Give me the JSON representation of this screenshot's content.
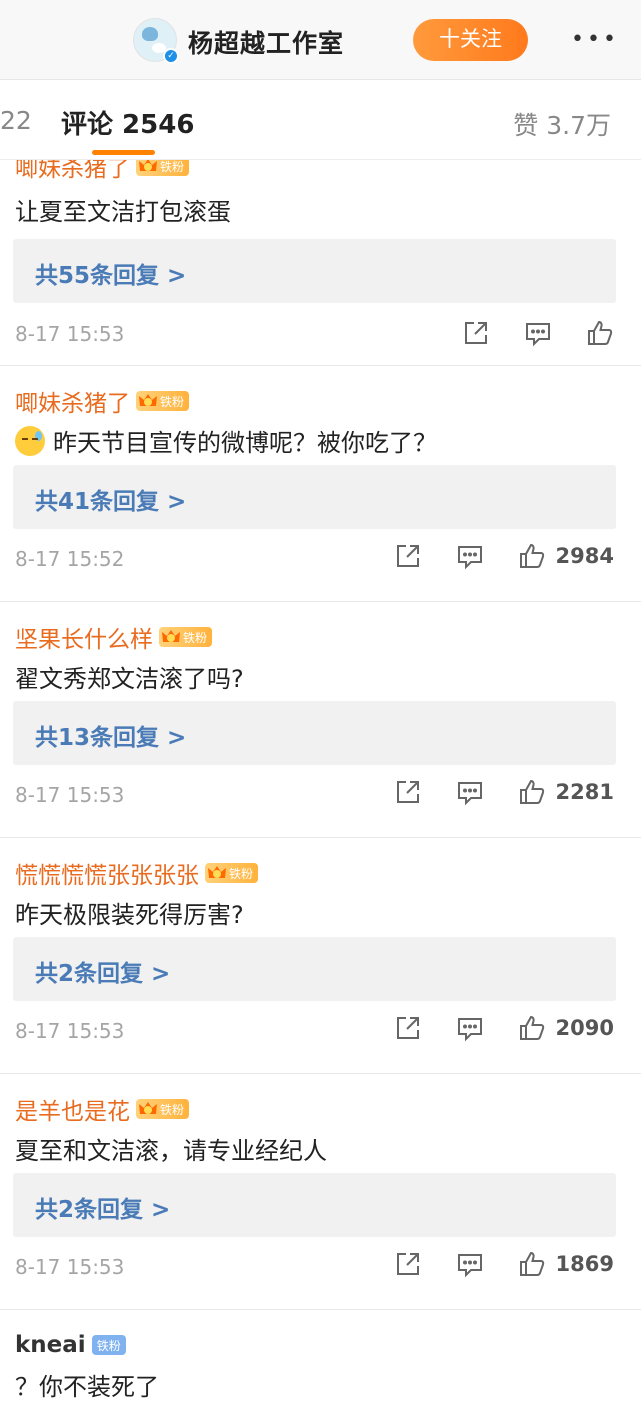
{
  "header": {
    "title": "杨超越工作室",
    "follow_label": "十关注",
    "more_label": "•••"
  },
  "tabs": {
    "prev_count": "22",
    "comments_label": "评论 2546",
    "likes_label": "赞 3.7万"
  },
  "colors": {
    "accent": "#ff8200",
    "name": "#e86b1f",
    "reply_link": "#4a7bb7",
    "reply_bg": "#f1f1f1",
    "fan_badge": "#ffb23c"
  },
  "comments": [
    {
      "name": "唧妹杀猪了",
      "badge": "铁粉",
      "text": "让夏至文洁打包滚蛋",
      "replies": "共55条回复 >",
      "time": "8-17 15:53",
      "likes": ""
    },
    {
      "name": "唧妹杀猪了",
      "badge": "铁粉",
      "text": "昨天节目宣传的微博呢？被你吃了？",
      "replies": "共41条回复 >",
      "time": "8-17 15:52",
      "likes": "2984"
    },
    {
      "name": "坚果长什么样",
      "badge": "铁粉",
      "text": "翟文秀郑文洁滚了吗?",
      "replies": "共13条回复 >",
      "time": "8-17 15:53",
      "likes": "2281"
    },
    {
      "name": "慌慌慌慌张张张张",
      "badge": "铁粉",
      "text": "昨天极限装死得厉害?",
      "replies": "共2条回复 >",
      "time": "8-17 15:53",
      "likes": "2090"
    },
    {
      "name": "是羊也是花",
      "badge": "铁粉",
      "text": "夏至和文洁滚，请专业经纪人",
      "replies": "共2条回复 >",
      "time": "8-17 15:53",
      "likes": "1869"
    },
    {
      "name": "kneai",
      "badge": "铁粉",
      "text": "？你不装死了",
      "replies": "",
      "time": "",
      "likes": ""
    }
  ]
}
